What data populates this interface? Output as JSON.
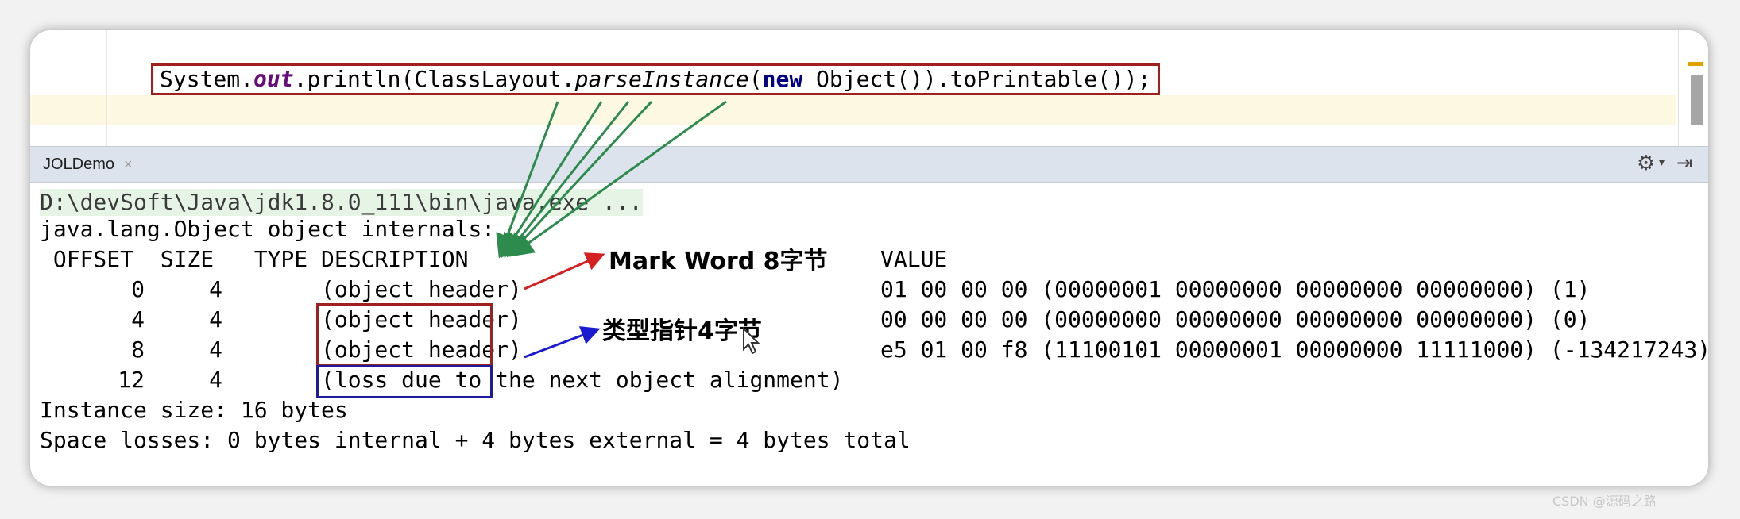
{
  "editor": {
    "code_segments": [
      {
        "text": "System.",
        "style": "plain"
      },
      {
        "text": "out",
        "style": "fld"
      },
      {
        "text": ".println(ClassLayout.",
        "style": "plain"
      },
      {
        "text": "parseInstance",
        "style": "it"
      },
      {
        "text": "(",
        "style": "plain"
      },
      {
        "text": "new",
        "style": "kw"
      },
      {
        "text": " Object()).toPrintable());",
        "style": "plain"
      }
    ]
  },
  "run_window": {
    "tab_label": "JOLDemo",
    "close_icon": "×",
    "icons": [
      "gear-icon",
      "pin-icon"
    ]
  },
  "console": {
    "command_line": "D:\\devSoft\\Java\\jdk1.8.0_111\\bin\\java.exe ...",
    "header_line": "java.lang.Object object internals:",
    "columns_left": " OFFSET  SIZE   TYPE DESCRIPTION",
    "column_value": "VALUE",
    "rows": [
      {
        "offset": "0",
        "size": "4",
        "description": "(object header)",
        "value": "01 00 00 00 (00000001 00000000 00000000 00000000) (1)"
      },
      {
        "offset": "4",
        "size": "4",
        "description": "(object header)",
        "value": "00 00 00 00 (00000000 00000000 00000000 00000000) (0)"
      },
      {
        "offset": "8",
        "size": "4",
        "description": "(object header)",
        "value": "e5 01 00 f8 (11100101 00000001 00000000 11111000) (-134217243)"
      },
      {
        "offset": "12",
        "size": "4",
        "description": "(loss due to the next object alignment)",
        "value": ""
      }
    ],
    "instance_size": "Instance size: 16 bytes",
    "space_losses": "Space losses: 0 bytes internal + 4 bytes external = 4 bytes total"
  },
  "annotations": {
    "mark_word": "Mark Word 8字节",
    "type_pointer": "类型指针4字节"
  },
  "colors": {
    "red_box": "#a02020",
    "blue_box": "#1c1c9c",
    "green_arrow": "#2e8b4e",
    "red_arrow": "#d42020",
    "blue_arrow": "#1a1ad0"
  },
  "watermark": "CSDN @源码之路"
}
